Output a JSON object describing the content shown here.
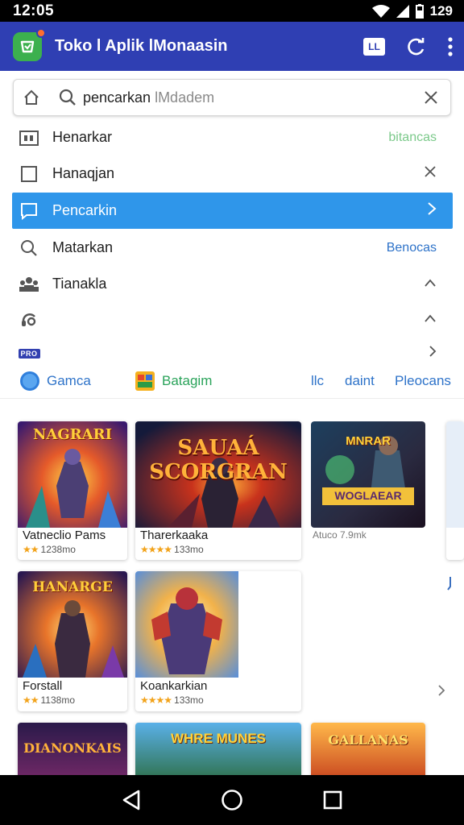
{
  "status": {
    "time": "12:05",
    "battery": "129"
  },
  "app_bar": {
    "title": "Toko l Aplik lMonaasin",
    "ll_label": "LL"
  },
  "search": {
    "typed": "pencarkan",
    "ghost": " lMdadem"
  },
  "menu": [
    {
      "label": "Henarkar",
      "trail": "bitancas",
      "trail_color": "#7bc98a"
    },
    {
      "label": "Hanaqjan",
      "trail": ""
    },
    {
      "label": "Pencarkin",
      "trail": ""
    },
    {
      "label": "Matarkan",
      "trail": "Benocas",
      "trail_color": "#2e73c9"
    },
    {
      "label": "Tianakla",
      "trail": ""
    },
    {
      "label": "",
      "trail": ""
    },
    {
      "label": "",
      "badge": "PRO",
      "trail": ""
    }
  ],
  "categories": [
    {
      "label": "Gamca"
    },
    {
      "label": "Batagim"
    },
    {
      "label": "llc"
    },
    {
      "label": "daint"
    },
    {
      "label": "Pleocans"
    }
  ],
  "cards": [
    {
      "title": "Vatneclio Pams",
      "meta": "1238mo",
      "stars": "★★",
      "art_text": "NAGRARI"
    },
    {
      "title": "Tharerkaaka",
      "meta": "133mo",
      "stars": "★★★★",
      "art_text": "SAUAÁ SCORGRAN"
    },
    {
      "title": "",
      "meta": "Atuco 7.9mk",
      "stars": "",
      "art_text": "MNRAR",
      "art_sub": "WOGLAEAR"
    },
    {
      "title": "Forstall",
      "meta": "1138mo",
      "stars": "★★",
      "art_text": "HANARGE"
    },
    {
      "title": "Koankarkian",
      "meta": "133mo",
      "stars": "★★★★",
      "art_text": ""
    },
    {
      "title": "",
      "meta": "",
      "stars": "",
      "art_text": "DIANONKAIS"
    },
    {
      "title": "",
      "meta": "",
      "stars": "",
      "art_text": "WHRE MUNES"
    },
    {
      "title": "",
      "meta": "",
      "stars": "",
      "art_text": "GALLANAS"
    }
  ],
  "colors": {
    "app_bar": "#2f3fb3",
    "active_row": "#2f96ea",
    "link": "#2e73c9",
    "star": "#f2a31b"
  }
}
